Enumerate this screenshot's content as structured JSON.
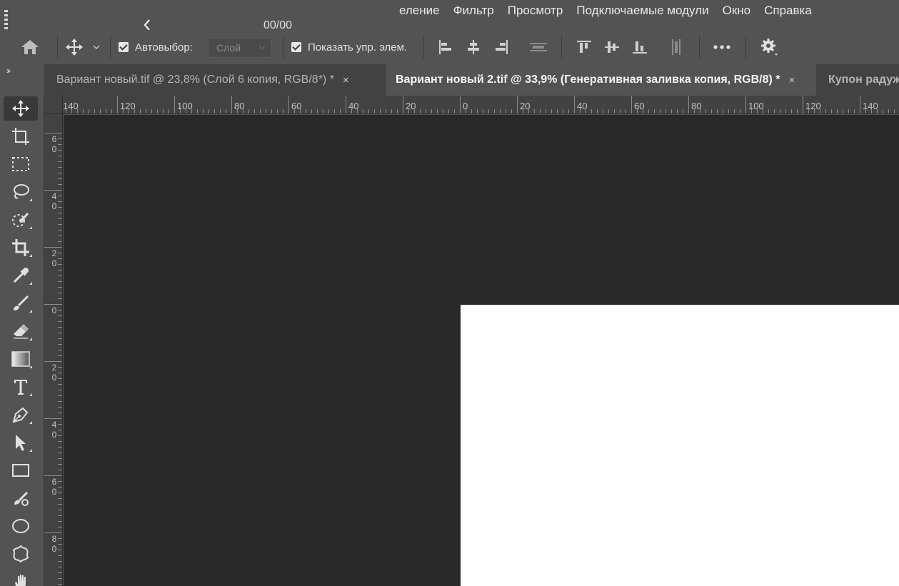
{
  "menu": {
    "items": [
      "еление",
      "Фильтр",
      "Просмотр",
      "Подключаемые модули",
      "Окно",
      "Справка"
    ]
  },
  "popup": {
    "back_icon": "chevron-left-icon",
    "counter": "00/00"
  },
  "options": {
    "home_icon": "home-icon",
    "move_icon": "move-icon",
    "auto_select_label": "Автовыбор:",
    "auto_select_checked": true,
    "layer_select_value": "Слой",
    "show_transform_label": "Показать упр. элем.",
    "show_transform_checked": true,
    "align_icons": [
      "align-left-icon",
      "align-horizontal-center-icon",
      "align-right-icon",
      "distribute-horizontal-icon",
      "align-top-icon",
      "align-vertical-center-icon",
      "align-bottom-icon",
      "distribute-vertical-icon"
    ],
    "more_icon": "more-icon",
    "settings_icon": "gear-icon"
  },
  "panel_toggle": "››",
  "tabs": [
    {
      "label": "Вариант новый.tif @ 23,8% (Слой 6 копия, RGB/8*) *",
      "active": false
    },
    {
      "label": "Вариант новый 2.tif @ 33,9% (Генеративная заливка копия, RGB/8) *",
      "active": true
    },
    {
      "label": "Купон радуж",
      "active": false
    }
  ],
  "tab_close_glyph": "×",
  "toolbar": {
    "tools": [
      "move-tool-icon",
      "artboard-tool-icon",
      "marquee-tool-icon",
      "lasso-tool-icon",
      "quick-selection-tool-icon",
      "crop-tool-icon",
      "eyedropper-tool-icon",
      "brush-tool-icon",
      "eraser-tool-icon",
      "gradient-tool-icon",
      "type-tool-icon",
      "pen-tool-icon",
      "path-selection-tool-icon",
      "rectangle-tool-icon",
      "spot-healing-tool-icon",
      "ellipse-tool-icon",
      "custom-shape-tool-icon",
      "hand-tool-icon"
    ]
  },
  "ruler_h": [
    "140",
    "120",
    "100",
    "80",
    "60",
    "40",
    "20",
    "0",
    "20",
    "40",
    "60",
    "80",
    "100",
    "120",
    "140"
  ],
  "ruler_v": [
    "60",
    "40",
    "20",
    "0",
    "20",
    "40",
    "60",
    "80"
  ],
  "colors": {
    "ui_panel": "#535353",
    "tab_bar": "#424242",
    "canvas_bg": "#282828",
    "document": "#ffffff"
  }
}
